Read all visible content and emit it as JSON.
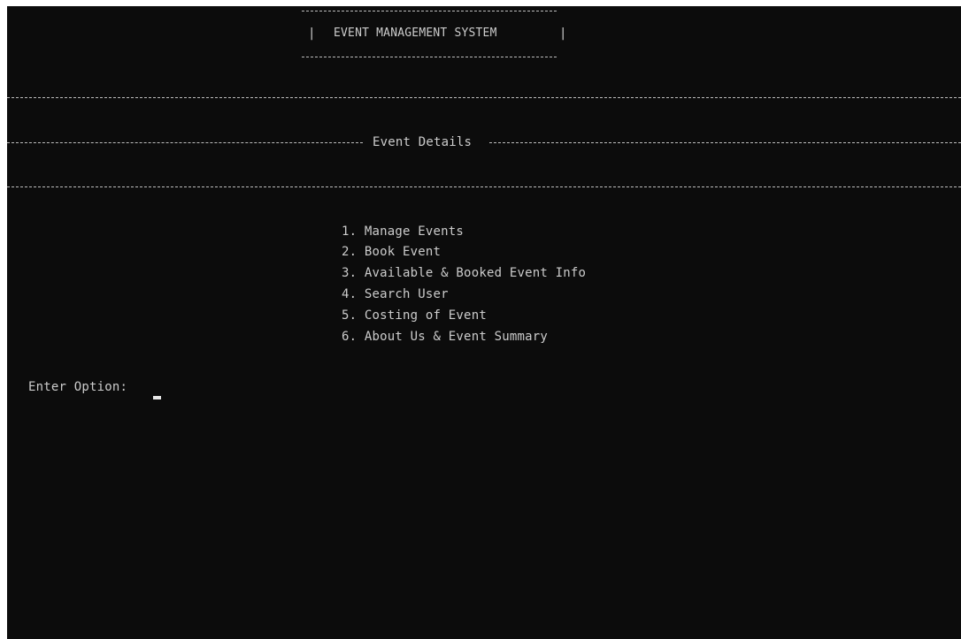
{
  "console": {
    "title_box": {
      "left_bar": "|",
      "title": "EVENT MANAGEMENT SYSTEM",
      "right_bar": "|"
    },
    "section_title": "Event Details",
    "menu": {
      "items": [
        "1. Manage Events",
        "2. Book Event",
        "3. Available & Booked Event Info",
        "4. Search User",
        "5. Costing of Event",
        "6. About Us & Event Summary"
      ]
    },
    "prompt": {
      "label": "Enter Option:",
      "value": ""
    },
    "colors": {
      "background": "#0c0c0c",
      "text": "#cccccc"
    }
  }
}
